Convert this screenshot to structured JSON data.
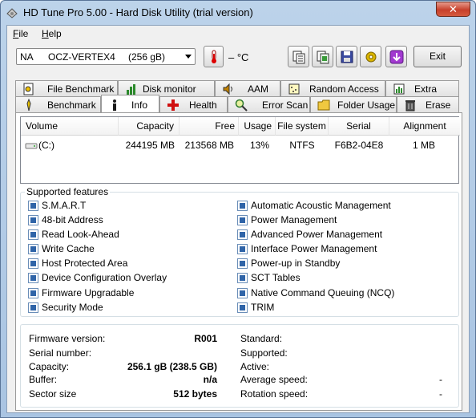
{
  "window": {
    "title": "HD Tune Pro 5.00 - Hard Disk Utility (trial version)",
    "close_label": "✕"
  },
  "menu": {
    "file": "File",
    "help": "Help"
  },
  "toolbar": {
    "drive_select": {
      "slot": "NA",
      "model": "OCZ-VERTEX4",
      "size": "(256 gB)"
    },
    "temperature": "– °C",
    "exit_label": "Exit",
    "icons": [
      "copy-text-icon",
      "copy-screenshot-icon",
      "save-icon",
      "options-icon",
      "download-icon"
    ]
  },
  "tabs": {
    "row1": [
      {
        "label": "File Benchmark",
        "icon": "file-benchmark-icon"
      },
      {
        "label": "Disk monitor",
        "icon": "disk-monitor-icon"
      },
      {
        "label": "AAM",
        "icon": "speaker-icon"
      },
      {
        "label": "Random Access",
        "icon": "random-access-icon"
      },
      {
        "label": "Extra tests",
        "icon": "extra-tests-icon"
      }
    ],
    "row2": [
      {
        "label": "Benchmark",
        "icon": "benchmark-icon"
      },
      {
        "label": "Info",
        "icon": "info-icon",
        "active": true
      },
      {
        "label": "Health",
        "icon": "health-icon"
      },
      {
        "label": "Error Scan",
        "icon": "magnifier-icon"
      },
      {
        "label": "Folder Usage",
        "icon": "folder-icon"
      },
      {
        "label": "Erase",
        "icon": "trash-icon"
      }
    ]
  },
  "volumes": {
    "columns": [
      "Volume",
      "Capacity",
      "Free",
      "Usage",
      "File system",
      "Serial",
      "Alignment"
    ],
    "rows": [
      {
        "volume": "(C:)",
        "capacity": "244195 MB",
        "free": "213568 MB",
        "usage": "13%",
        "filesystem": "NTFS",
        "serial": "F6B2-04E8",
        "alignment": "1 MB"
      }
    ]
  },
  "features": {
    "title": "Supported features",
    "left": [
      "S.M.A.R.T",
      "48-bit Address",
      "Read Look-Ahead",
      "Write Cache",
      "Host Protected Area",
      "Device Configuration Overlay",
      "Firmware Upgradable",
      "Security Mode"
    ],
    "right": [
      "Automatic Acoustic Management",
      "Power Management",
      "Advanced Power Management",
      "Interface Power Management",
      "Power-up in Standby",
      "SCT Tables",
      "Native Command Queuing (NCQ)",
      "TRIM"
    ],
    "checked_color": "#2f64a8"
  },
  "details": {
    "left": [
      {
        "label": "Firmware version:",
        "value": "R001"
      },
      {
        "label": "Serial number:",
        "value": ""
      },
      {
        "label": "Capacity:",
        "value": "256.1 gB (238.5 GB)"
      },
      {
        "label": "Buffer:",
        "value": "n/a"
      },
      {
        "label": "Sector size",
        "value": "512 bytes"
      }
    ],
    "right": [
      {
        "label": "Standard:",
        "value": ""
      },
      {
        "label": "Supported:",
        "value": ""
      },
      {
        "label": "Active:",
        "value": ""
      },
      {
        "label": "Average speed:",
        "value": "-"
      },
      {
        "label": "Rotation speed:",
        "value": "-"
      }
    ]
  }
}
